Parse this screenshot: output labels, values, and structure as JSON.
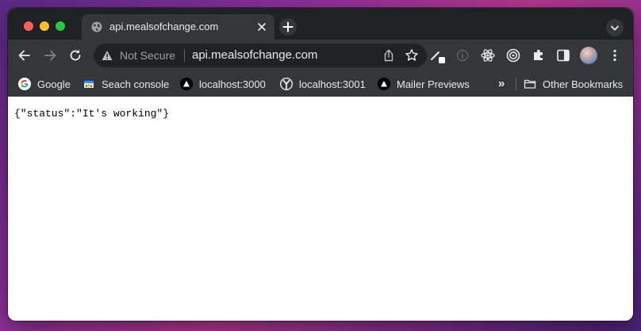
{
  "tab": {
    "title": "api.mealsofchange.com",
    "favicon": "globe-icon"
  },
  "toolbar": {
    "security_label": "Not Secure",
    "url": "api.mealsofchange.com",
    "extensions": [
      "pen-extension-icon",
      "info-icon",
      "react-icon",
      "target-icon",
      "puzzle-icon",
      "side-panel-icon"
    ]
  },
  "bookmarks": {
    "items": [
      {
        "label": "Google",
        "icon": "google-icon"
      },
      {
        "label": "Seach console",
        "icon": "search-console-icon"
      },
      {
        "label": "localhost:3000",
        "icon": "triangle-icon"
      },
      {
        "label": "localhost:3001",
        "icon": "fork-icon"
      },
      {
        "label": "Mailer Previews",
        "icon": "triangle-icon"
      }
    ],
    "overflow": "»",
    "other_label": "Other Bookmarks"
  },
  "page": {
    "body_text": "{\"status\":\"It's working\"}"
  },
  "colors": {
    "titlebar": "#202124",
    "toolbar": "#35363a",
    "text_light": "#e8eaed",
    "text_muted": "#9aa0a6",
    "close": "#ff5f57",
    "minimize": "#febc2e",
    "maximize": "#28c840"
  }
}
